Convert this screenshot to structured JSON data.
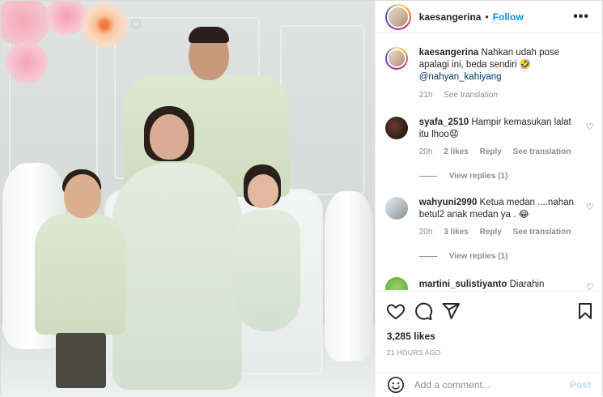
{
  "header": {
    "username": "kaesangerina",
    "separator": "•",
    "follow_label": "Follow",
    "more_icon": "more-options-icon"
  },
  "caption": {
    "username": "kaesangerina",
    "text": "Nahkan udah pose apalagi ini, beda sendiri 🤣",
    "mention": "@nahyan_kahiyang",
    "time": "21h",
    "translate_label": "See translation"
  },
  "comments": [
    {
      "username": "syafa_2510",
      "text": "Hampir kemasukan lalat itu lhoo😧",
      "time": "20h",
      "likes": "2 likes",
      "reply_label": "Reply",
      "translate_label": "See translation",
      "view_replies": "View replies (1)"
    },
    {
      "username": "wahyuni2990",
      "text": "Ketua medan ....nahan betul2 anak medan ya . 😂",
      "time": "20h",
      "likes": "3 likes",
      "reply_label": "Reply",
      "translate_label": "See translation",
      "view_replies": "View replies (1)"
    },
    {
      "username": "martini_sulistiyanto",
      "text": "Diarahin"
    }
  ],
  "actions": {
    "like_icon": "heart-icon",
    "comment_icon": "comment-icon",
    "share_icon": "share-icon",
    "save_icon": "bookmark-icon"
  },
  "likes": "3,285 likes",
  "timestamp": "21 HOURS AGO",
  "composer": {
    "emoji_icon": "emoji-icon",
    "placeholder": "Add a comment...",
    "post_label": "Post"
  },
  "colors": {
    "link_blue": "#0095f6",
    "post_disabled": "#b2dffc",
    "meta_gray": "#8e8e8e",
    "mention_blue": "#00376b"
  }
}
